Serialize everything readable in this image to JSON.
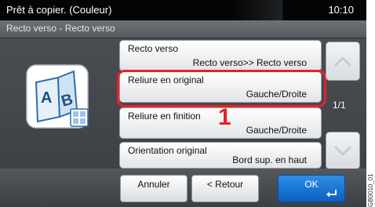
{
  "status": {
    "title": "Prêt à copier. (Couleur)",
    "time": "10:10"
  },
  "subheader": {
    "title": "Recto verso - Recto verso"
  },
  "illustration_icon": "duplex-book-icon",
  "options": [
    {
      "label": "Recto verso",
      "value": "Recto verso>> Recto verso"
    },
    {
      "label": "Reliure en original",
      "value": "Gauche/Droite"
    },
    {
      "label": "Reliure en finition",
      "value": "Gauche/Droite"
    },
    {
      "label": "Orientation original",
      "value": "Bord sup. en haut"
    }
  ],
  "annotation": {
    "step": "1",
    "color": "#e8202a"
  },
  "pagination": {
    "page": "1/1",
    "up_icon": "chevron-up-icon",
    "down_icon": "chevron-down-icon"
  },
  "footer": {
    "cancel": "Annuler",
    "back": "< Retour",
    "ok": "OK",
    "ok_icon": "enter-icon"
  },
  "figure_code": "GB0010_01",
  "colors": {
    "ok_button": "#1f7ad8",
    "highlight": "#e8202a",
    "screen_bg": "#3b3f44"
  }
}
